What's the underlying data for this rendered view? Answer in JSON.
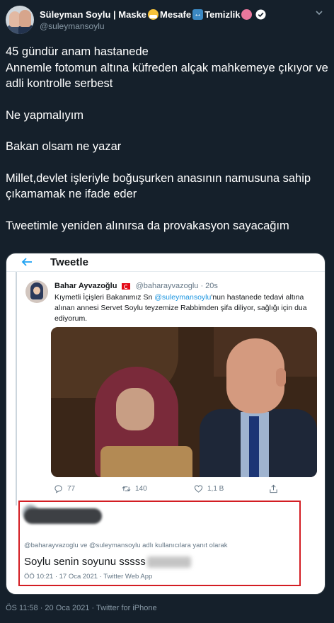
{
  "author": {
    "name_part1": "Süleyman Soylu | Maske",
    "name_part2": " Mesafe",
    "name_part3": " Temizlik",
    "handle": "@suleymansoylu",
    "emoji_icons": [
      "face-with-mask-icon",
      "left-right-arrow-icon",
      "microbe-icon"
    ],
    "verified": true
  },
  "tweet": {
    "lines": [
      "45 gündür anam hastanede",
      "Annemle fotomun altına küfreden alçak mahkemeye çıkıyor ve adli kontrolle serbest",
      "Ne yapmalıyım",
      "Bakan olsam ne yazar",
      "Millet,devlet işleriyle boğuşurken anasının namusuna sahip çıkamamak ne ifade eder",
      "Tweetimle yeniden alınırsa da provakasyon sayacağım"
    ]
  },
  "embedded": {
    "header_title": "Tweetle",
    "quoted": {
      "name": "Bahar Ayvazoğlu",
      "handle": "@baharayvazoglu · 20s",
      "text_before": "Kıymetli İçişleri Bakanımız Sn ",
      "mention": "@suleymansoylu",
      "text_after": "'nun hastanede tedavi altına alınan annesi Servet Soylu teyzemize Rabbimden şifa diliyor, sağlığı için dua ediyorum.",
      "replies": "77",
      "retweets": "140",
      "likes": "1,1 B"
    },
    "reply": {
      "reply_to": "@baharayvazoglu ve @suleymansoylu adlı kullanıcılara yanıt olarak",
      "text": "Soylu senin soyunu sssss",
      "meta": "ÖÖ 10:21 · 17 Oca 2021 · Twitter Web App"
    }
  },
  "footer": "ÖS 11:58 · 20 Oca 2021 · Twitter for iPhone",
  "colors": {
    "background": "#15202b",
    "link": "#1b95e0",
    "highlight_box": "#d31d23",
    "verified": "#ffffff"
  }
}
